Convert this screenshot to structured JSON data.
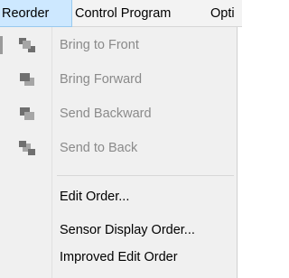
{
  "menubar": {
    "items": [
      {
        "label": "Reorder"
      },
      {
        "label": "Control Program"
      },
      {
        "label": "Opti"
      }
    ]
  },
  "reorder_menu": {
    "arrange_items": [
      {
        "label": "Bring to Front",
        "icon": "bring-to-front-icon",
        "enabled": false
      },
      {
        "label": "Bring Forward",
        "icon": "bring-forward-icon",
        "enabled": false
      },
      {
        "label": "Send Backward",
        "icon": "send-backward-icon",
        "enabled": false
      },
      {
        "label": "Send to Back",
        "icon": "send-to-back-icon",
        "enabled": false
      }
    ],
    "order_items": [
      {
        "label": "Edit Order..."
      },
      {
        "label": "Sensor Display Order..."
      },
      {
        "label": "Improved Edit Order"
      }
    ]
  },
  "colors": {
    "active_menu_bg": "#cde8ff",
    "menu_bg": "#f0f0f0",
    "disabled_text": "#8a8a8a",
    "icon_gray": "#7f7f7f"
  }
}
